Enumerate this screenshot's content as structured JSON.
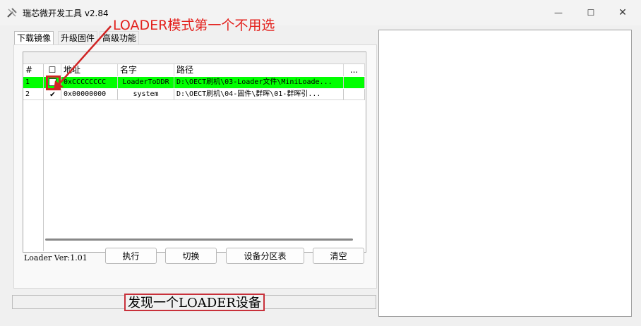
{
  "window": {
    "title": "瑞芯微开发工具 v2.84",
    "controls": {
      "minimize": "—",
      "maximize": "☐",
      "close": "✕"
    }
  },
  "annotation": {
    "top_note": "LOADER模式第一个不用选",
    "color": "#e3201c"
  },
  "tabs": [
    {
      "label": "下载镜像",
      "active": true
    },
    {
      "label": "升级固件",
      "active": false
    },
    {
      "label": "高级功能",
      "active": false
    }
  ],
  "table": {
    "headers": {
      "index": "#",
      "check": "☐",
      "address": "地址",
      "name": "名字",
      "path": "路径",
      "more": "..."
    },
    "rows": [
      {
        "index": "1",
        "checked": false,
        "address": "0xCCCCCCCC",
        "name": "LoaderToDDR",
        "path": "D:\\OECT刷机\\03-Loader文件\\MiniLoade...",
        "highlight": "#00ff00"
      },
      {
        "index": "2",
        "checked": true,
        "address": "0x00000000",
        "name": "system",
        "path": "D:\\OECT刷机\\04-固件\\群晖\\01-群晖引..."
      }
    ]
  },
  "loader_version": "Loader Ver:1.01",
  "buttons": {
    "run": "执行",
    "switch": "切换",
    "partition": "设备分区表",
    "clear": "清空"
  },
  "status": {
    "message": "发现一个LOADER设备"
  }
}
